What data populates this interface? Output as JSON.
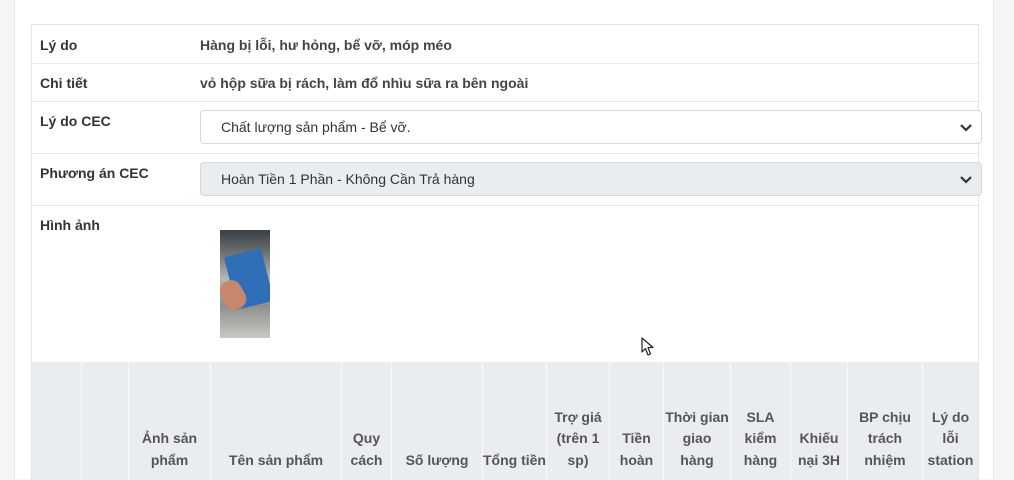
{
  "details": {
    "reason_label": "Lý do",
    "reason_value": "Hàng bị lỗi, hư hỏng, bể vỡ, móp méo",
    "detail_label": "Chi tiết",
    "detail_value": "vỏ hộp sữa bị rách, làm đổ nhìu sữa ra bên ngoài",
    "cec_reason_label": "Lý do CEC",
    "cec_reason_selected": "Chất lượng sản phẩm - Bể vỡ.",
    "cec_plan_label": "Phương án CEC",
    "cec_plan_selected": "Hoàn Tiền 1 Phần - Không Cần Trả hàng",
    "image_label": "Hình ảnh"
  },
  "table": {
    "headers": [
      "",
      "",
      "Ảnh sản phẩm",
      "Tên sản phẩm",
      "Quy cách",
      "Số lượng",
      "Tổng tiền",
      "Trợ giá (trên 1 sp)",
      "Tiền hoàn",
      "Thời gian giao hàng",
      "SLA kiểm hàng",
      "Khiếu nại 3H",
      "BP chịu trách nhiệm",
      "Lý do lỗi station"
    ]
  },
  "colors": {
    "header_bg": "#e9edf0",
    "disabled_select_bg": "#e9edef"
  }
}
